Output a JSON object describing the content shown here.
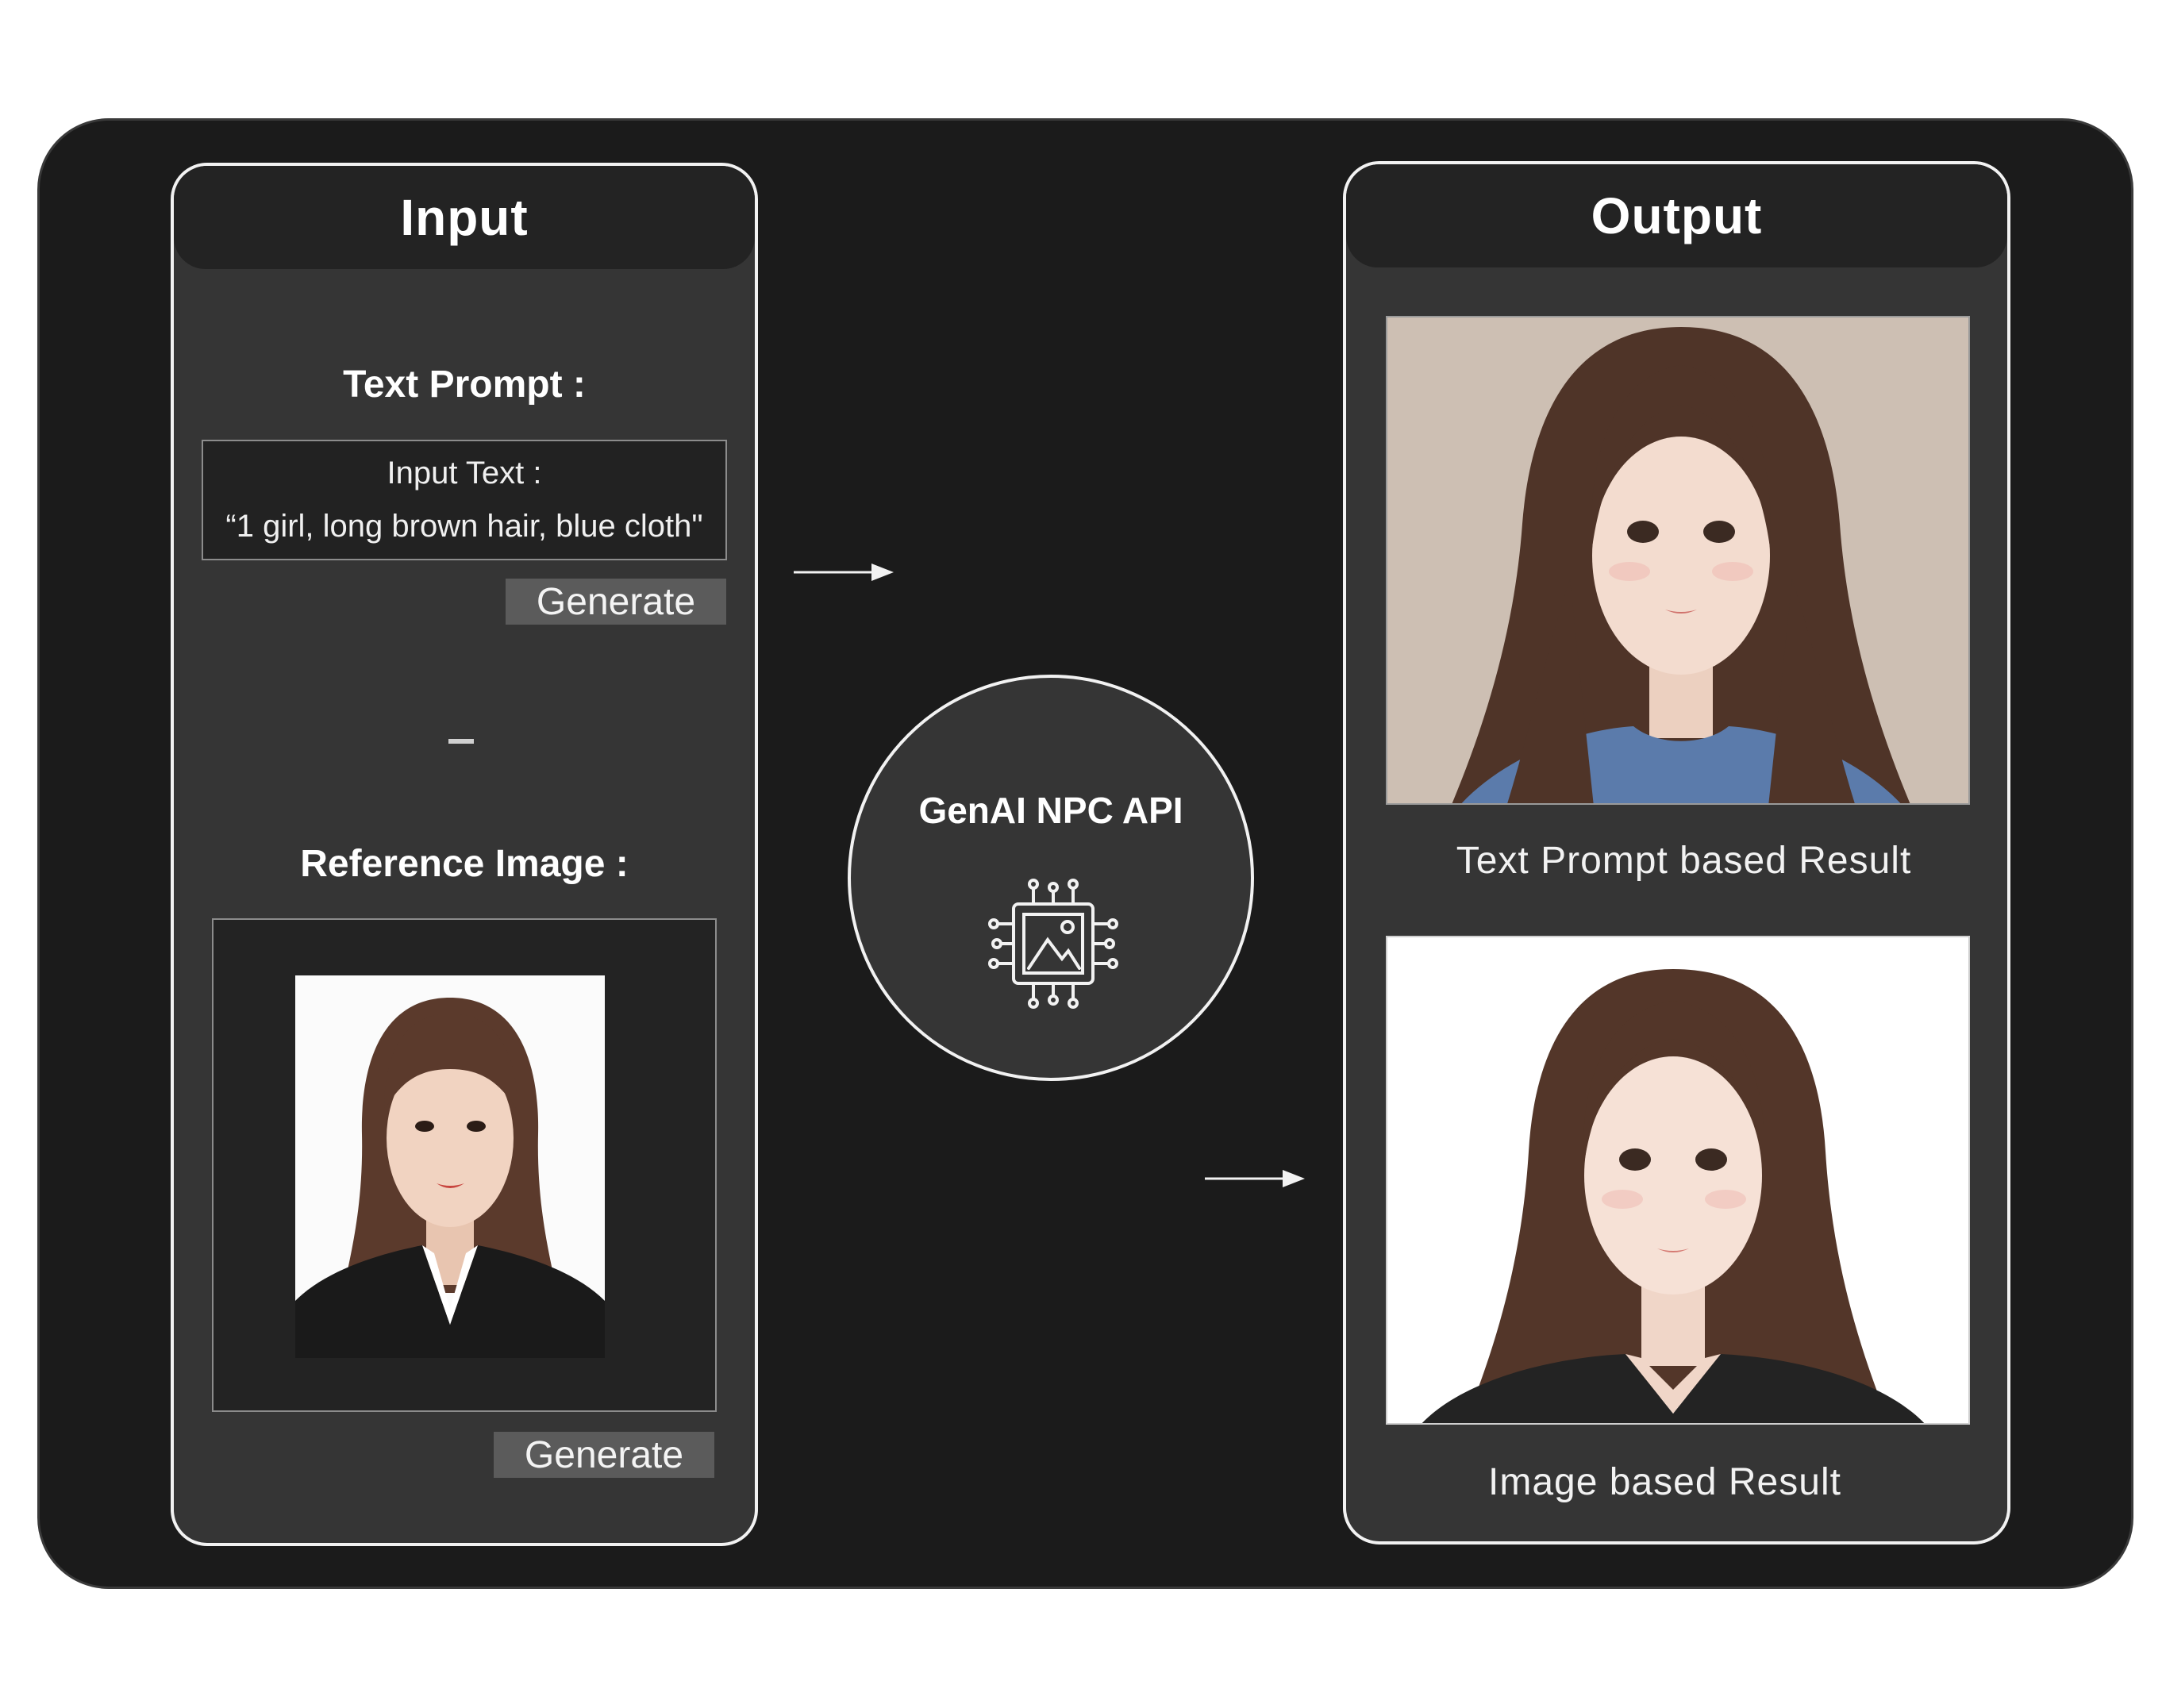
{
  "input_panel": {
    "title": "Input",
    "text_prompt_label": "Text Prompt :",
    "input_text_label": "Input Text :",
    "input_text_value": "“1 girl, long brown hair, blue cloth\"",
    "generate_label_1": "Generate",
    "separator": "–",
    "reference_image_label": "Reference Image :",
    "generate_label_2": "Generate"
  },
  "api": {
    "label": "GenAI NPC API",
    "icon": "ai-chip-image-icon"
  },
  "output_panel": {
    "title": "Output",
    "text_result_caption": "Text Prompt based Result",
    "image_result_caption": "Image based Result"
  },
  "colors": {
    "frame_bg": "#1b1b1b",
    "panel_bg": "#353535",
    "header_bg": "#232323",
    "button_bg": "#5b5b5b",
    "border": "#f2f2f2"
  }
}
